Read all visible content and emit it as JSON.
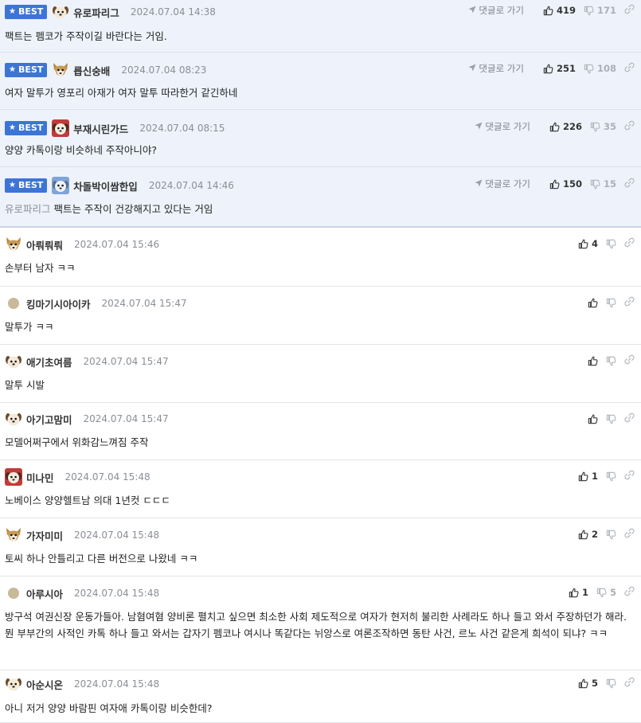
{
  "goto_label": "댓글로 가기",
  "best_label": "BEST",
  "comments": [
    {
      "best": true,
      "avatar": "puppy",
      "nick": "유로파리그",
      "date": "2024.07.04 14:38",
      "quote": "",
      "text": "팩트는 펨코가 주작이길 바란다는 거임.",
      "up": "419",
      "down": "171"
    },
    {
      "best": true,
      "avatar": "fox-puppy",
      "nick": "릅신숭배",
      "date": "2024.07.04 08:23",
      "quote": "",
      "text": "여자 말투가 영포리 아재가 여자 말투 따라한거 같긴하네",
      "up": "251",
      "down": "108"
    },
    {
      "best": true,
      "avatar": "red-puppy",
      "nick": "부재시린가드",
      "date": "2024.07.04 08:15",
      "quote": "",
      "text": "양양 카톡이랑 비슷하네 주작아니야?",
      "up": "226",
      "down": "35"
    },
    {
      "best": true,
      "avatar": "blue-puppy",
      "nick": "차돌박이쌈한입",
      "date": "2024.07.04 14:46",
      "quote": "유로파리그",
      "text": "팩트는 주작이 건강해지고 있다는 거임",
      "up": "150",
      "down": "15"
    },
    {
      "best": false,
      "avatar": "fox-puppy",
      "nick": "아뤄뤄뤄",
      "date": "2024.07.04 15:46",
      "quote": "",
      "text": "손부터 남자 ㅋㅋ",
      "up": "4",
      "down": ""
    },
    {
      "best": false,
      "avatar": "dot",
      "nick": "킹마기시아이카",
      "date": "2024.07.04 15:47",
      "quote": "",
      "text": "말투가 ㅋㅋ",
      "up": "",
      "down": ""
    },
    {
      "best": false,
      "avatar": "puppy",
      "nick": "애기초여름",
      "date": "2024.07.04 15:47",
      "quote": "",
      "text": "말투 시발",
      "up": "",
      "down": ""
    },
    {
      "best": false,
      "avatar": "puppy",
      "nick": "아기고맘미",
      "date": "2024.07.04 15:47",
      "quote": "",
      "text": "모델어쩌구에서 위화감느껴짐 주작",
      "up": "",
      "down": ""
    },
    {
      "best": false,
      "avatar": "red-puppy",
      "nick": "미나민",
      "date": "2024.07.04 15:48",
      "quote": "",
      "text": "노베이스 양양헬트남 의대 1년컷 ㄷㄷㄷ",
      "up": "1",
      "down": ""
    },
    {
      "best": false,
      "avatar": "fox-puppy",
      "nick": "가자미미",
      "date": "2024.07.04 15:48",
      "quote": "",
      "text": "토씨 하나 안틀리고 다른 버전으로 나왔네 ㅋㅋ",
      "up": "2",
      "down": ""
    },
    {
      "best": false,
      "avatar": "dot",
      "nick": "아루시아",
      "date": "2024.07.04 15:48",
      "quote": "",
      "text": "방구석 여권신장 운동가들아. 남혐여혐 양비론 펼치고 싶으면 최소한 사회 제도적으로 여자가 현저히 불리한 사례라도 하나 들고 와서 주장하던가 해라. 뭔 부부간의 사적인 카톡 하나 들고 와서는 갑자기 펨코나 여시나 똑같다는 뉘앙스로 여론조작하면 동탄 사건, 르노 사건 같은게 희석이 되냐? ㅋㅋ",
      "up": "1",
      "down": "5"
    },
    {
      "best": false,
      "avatar": "puppy",
      "nick": "아순시온",
      "date": "2024.07.04 15:48",
      "quote": "",
      "text": "아니 저거 양양 바람핀 여자애 카톡이랑 비슷한데?",
      "up": "5",
      "down": ""
    }
  ]
}
